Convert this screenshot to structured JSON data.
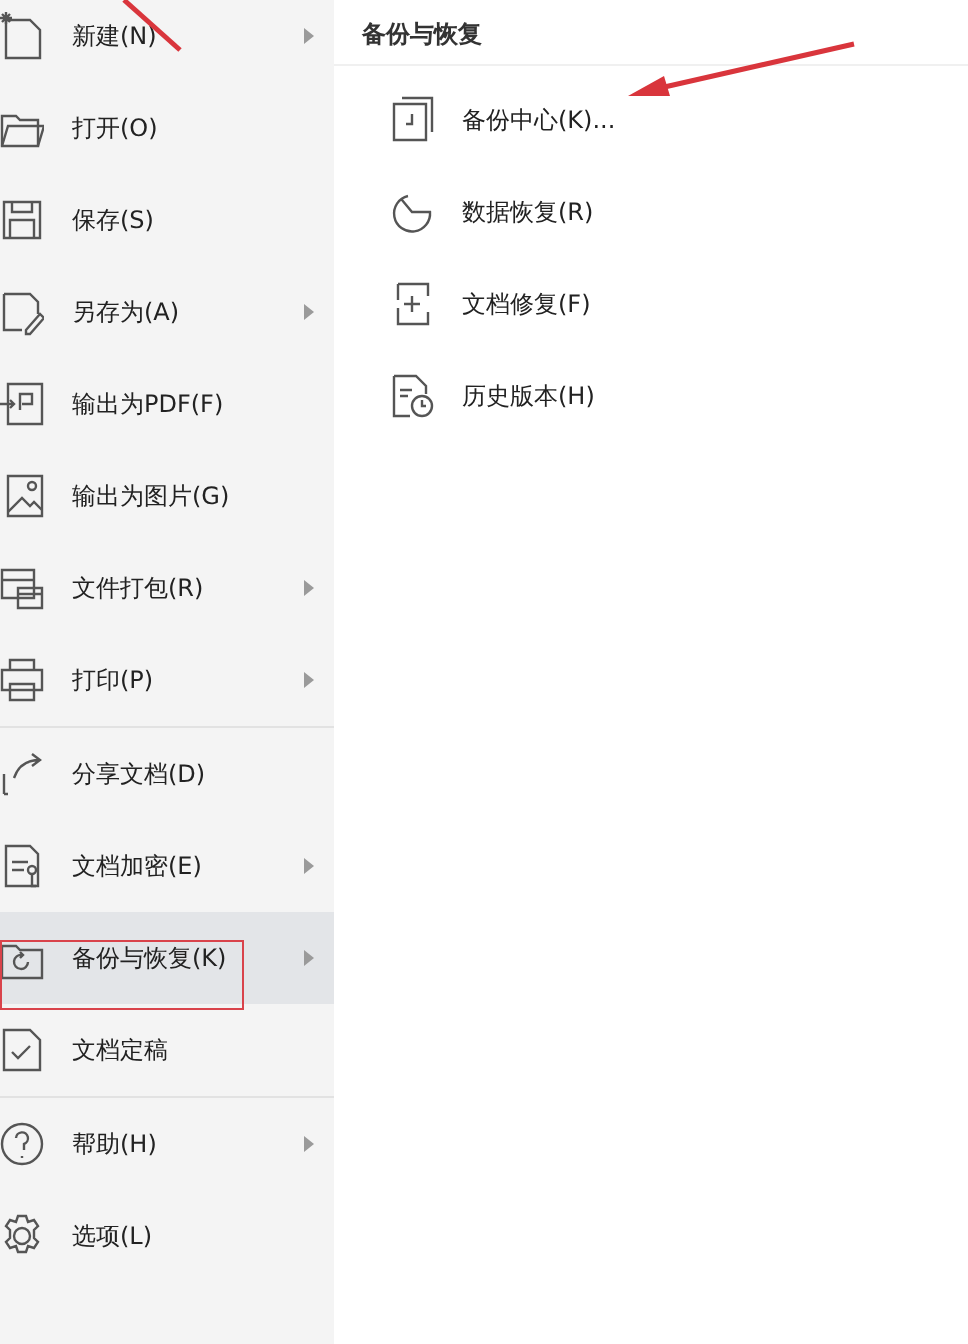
{
  "menu": {
    "groups": [
      [
        {
          "label": "新建(N)",
          "submenu": true,
          "selected": false
        },
        {
          "label": "打开(O)",
          "submenu": false,
          "selected": false
        },
        {
          "label": "保存(S)",
          "submenu": false,
          "selected": false
        },
        {
          "label": "另存为(A)",
          "submenu": true,
          "selected": false
        },
        {
          "label": "输出为PDF(F)",
          "submenu": false,
          "selected": false
        },
        {
          "label": "输出为图片(G)",
          "submenu": false,
          "selected": false
        },
        {
          "label": "文件打包(R)",
          "submenu": true,
          "selected": false
        },
        {
          "label": "打印(P)",
          "submenu": true,
          "selected": false
        }
      ],
      [
        {
          "label": "分享文档(D)",
          "submenu": false,
          "selected": false
        },
        {
          "label": "文档加密(E)",
          "submenu": true,
          "selected": false
        },
        {
          "label": "备份与恢复(K)",
          "submenu": true,
          "selected": true
        },
        {
          "label": "文档定稿",
          "submenu": false,
          "selected": false
        }
      ],
      [
        {
          "label": "帮助(H)",
          "submenu": true,
          "selected": false
        },
        {
          "label": "选项(L)",
          "submenu": false,
          "selected": false
        }
      ]
    ]
  },
  "submenu": {
    "title": "备份与恢复",
    "items": [
      {
        "label": "备份中心(K)..."
      },
      {
        "label": "数据恢复(R)"
      },
      {
        "label": "文档修复(F)"
      },
      {
        "label": "历史版本(H)"
      }
    ]
  }
}
